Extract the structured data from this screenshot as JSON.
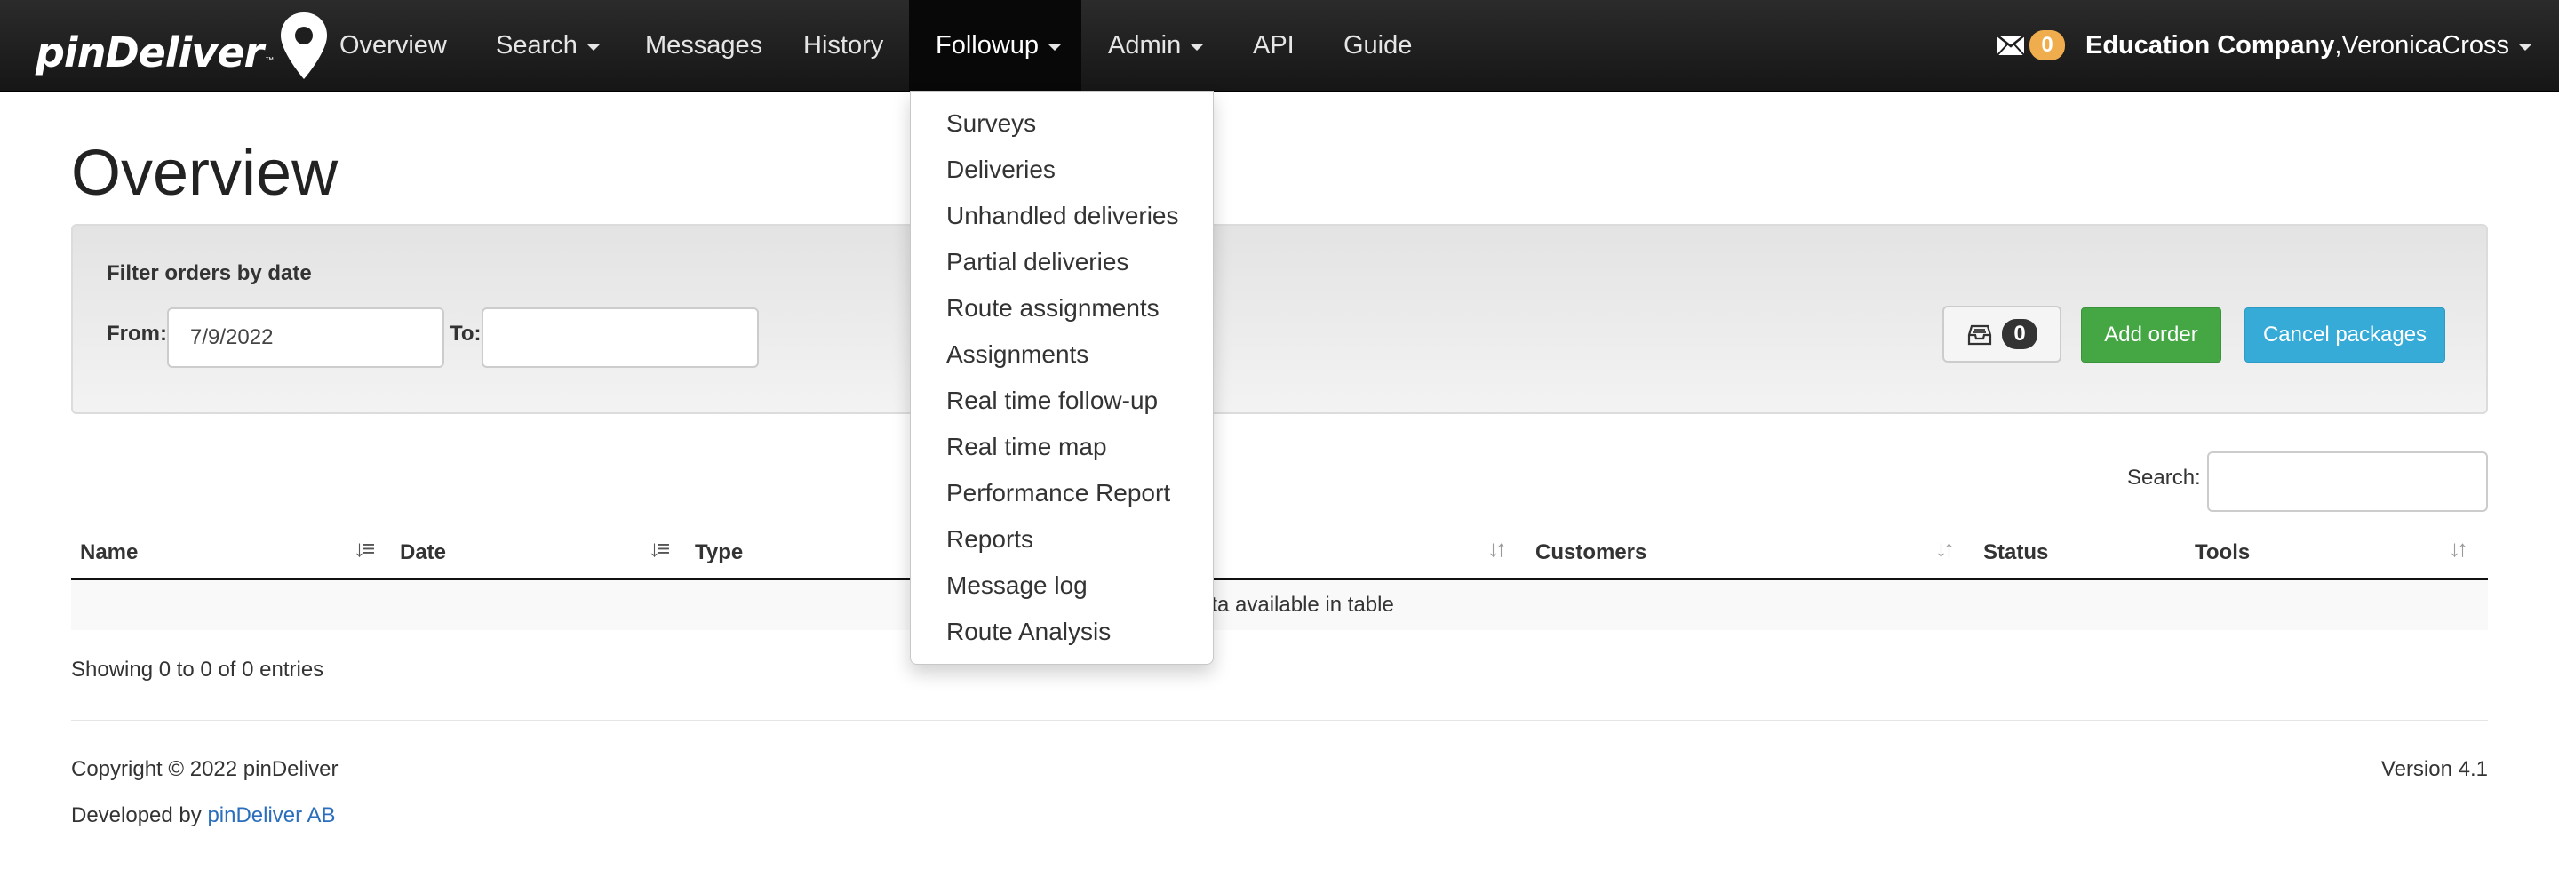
{
  "brand": {
    "name": "pinDeliver",
    "tm": "™"
  },
  "nav": {
    "overview": "Overview",
    "search": "Search",
    "messages": "Messages",
    "history": "History",
    "followup": "Followup",
    "admin": "Admin",
    "api": "API",
    "guide": "Guide"
  },
  "mail_count": "0",
  "user": {
    "company": "Education Company",
    "separator": ", ",
    "name": "VeronicaCross"
  },
  "followup_menu": [
    "Surveys",
    "Deliveries",
    "Unhandled deliveries",
    "Partial deliveries",
    "Route assignments",
    "Assignments",
    "Real time follow-up",
    "Real time map",
    "Performance Report",
    "Reports",
    "Message log",
    "Route Analysis"
  ],
  "page_title": "Overview",
  "filter": {
    "title": "Filter orders by date",
    "from_label": "From:",
    "from_value": "7/9/2022",
    "to_label": "To:",
    "to_value": ""
  },
  "inbox_count": "0",
  "buttons": {
    "add_order": "Add order",
    "cancel_packages": "Cancel packages"
  },
  "search_label": "Search:",
  "table": {
    "columns": [
      "Name",
      "Date",
      "Type",
      "Customers",
      "Status",
      "Tools"
    ],
    "empty_text": "ata available in table"
  },
  "showing": "Showing 0 to 0 of 0 entries",
  "footer": {
    "copyright": "Copyright © 2022 pinDeliver",
    "version": "Version 4.1",
    "developed_by": "Developed by ",
    "developer_link": "pinDeliver AB"
  }
}
